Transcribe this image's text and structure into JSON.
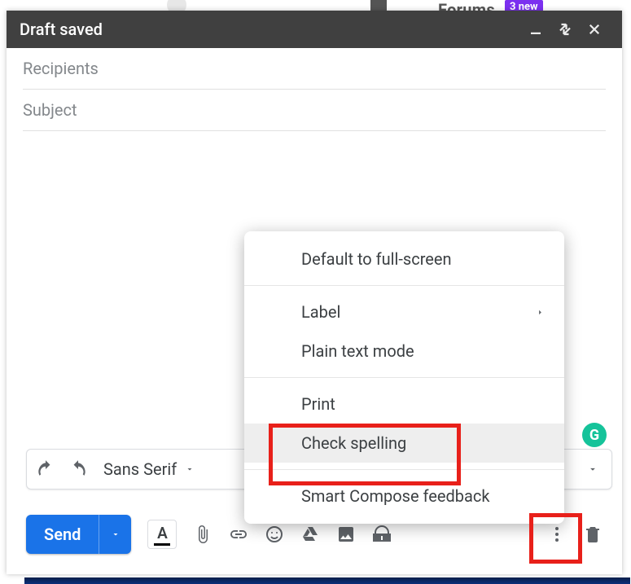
{
  "background": {
    "forums_label": "Forums",
    "new_badge": "3 new"
  },
  "compose": {
    "title": "Draft saved",
    "recipients_placeholder": "Recipients",
    "subject_placeholder": "Subject",
    "font_name": "Sans Serif",
    "send_label": "Send"
  },
  "menu": {
    "full_screen": "Default to full-screen",
    "label": "Label",
    "plain_text": "Plain text mode",
    "print": "Print",
    "check_spelling": "Check spelling",
    "smart_compose_feedback": "Smart Compose feedback"
  },
  "colors": {
    "send_button": "#1a73e8",
    "highlight": "#e8201a",
    "grammarly": "#15c39a"
  }
}
